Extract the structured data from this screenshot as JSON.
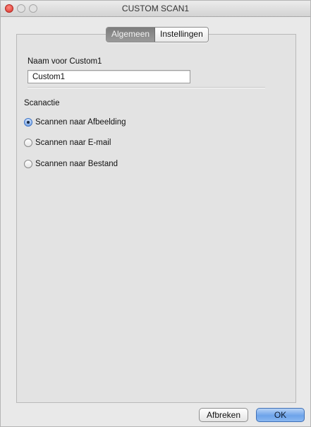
{
  "window": {
    "title": "CUSTOM SCAN1"
  },
  "tabs": [
    {
      "label": "Algemeen",
      "active": true
    },
    {
      "label": "Instellingen",
      "active": false
    }
  ],
  "name_section": {
    "label": "Naam voor Custom1",
    "value": "Custom1"
  },
  "scan_action": {
    "label": "Scanactie",
    "options": [
      {
        "label": "Scannen naar Afbeelding",
        "selected": true
      },
      {
        "label": "Scannen naar E-mail",
        "selected": false
      },
      {
        "label": "Scannen naar Bestand",
        "selected": false
      }
    ]
  },
  "buttons": {
    "cancel_label": "Afbreken",
    "ok_label": "OK"
  },
  "colors": {
    "close_button": "#d9322b",
    "default_button": "#6da3ea",
    "selected_radio": "#3a72c8"
  }
}
